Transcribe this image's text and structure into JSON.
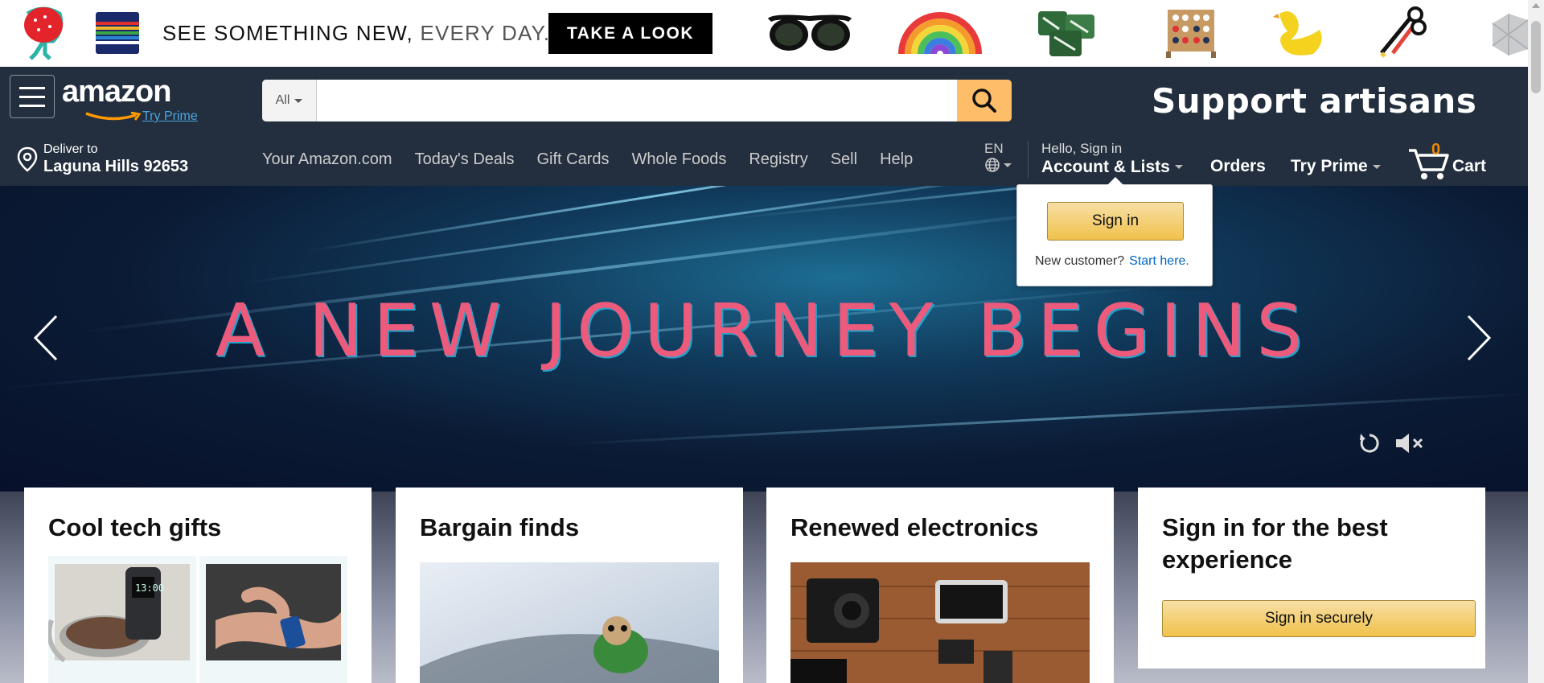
{
  "promo": {
    "tagline_main": "SEE SOMETHING NEW,",
    "tagline_light": "EVERY DAY.",
    "cta_label": "TAKE A LOOK"
  },
  "header": {
    "logo_text": "amazon",
    "logo_prime": "Try Prime",
    "search_category": "All",
    "search_placeholder": "",
    "banner_text": "Support artisans"
  },
  "subnav": {
    "deliver_small": "Deliver to",
    "deliver_location": "Laguna Hills 92653",
    "links": [
      "Your Amazon.com",
      "Today's Deals",
      "Gift Cards",
      "Whole Foods",
      "Registry",
      "Sell",
      "Help"
    ],
    "language": "EN",
    "account_greeting": "Hello, Sign in",
    "account_label": "Account & Lists",
    "orders_label": "Orders",
    "prime_label": "Try Prime",
    "cart_count": "0",
    "cart_label": "Cart"
  },
  "flyout": {
    "signin_label": "Sign in",
    "new_customer": "New customer?",
    "start_here": "Start here."
  },
  "hero": {
    "title": "A NEW JOURNEY BEGINS"
  },
  "cards": [
    {
      "title": "Cool tech gifts"
    },
    {
      "title": "Bargain finds"
    },
    {
      "title": "Renewed electronics"
    },
    {
      "title": "Sign in for the best experience",
      "button": "Sign in securely"
    }
  ],
  "colors": {
    "nav_bg": "#232f3e",
    "search_button": "#febd69",
    "accent_orange": "#f08804",
    "link_blue": "#0066c0",
    "hero_text": "#ec5a7c"
  }
}
